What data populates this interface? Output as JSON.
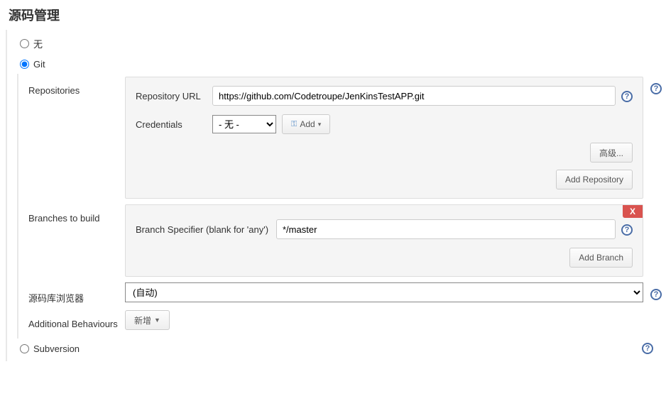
{
  "title": "源码管理",
  "scm": {
    "none_label": "无",
    "git_label": "Git",
    "subversion_label": "Subversion"
  },
  "repositories": {
    "section_label": "Repositories",
    "url_label": "Repository URL",
    "url_value": "https://github.com/Codetroupe/JenKinsTestAPP.git",
    "credentials_label": "Credentials",
    "credentials_value": "- 无 -",
    "add_button": "Add",
    "advanced_button": "高级...",
    "add_repo_button": "Add Repository"
  },
  "branches": {
    "section_label": "Branches to build",
    "specifier_label": "Branch Specifier (blank for 'any')",
    "specifier_value": "*/master",
    "add_branch_button": "Add Branch",
    "delete_label": "X"
  },
  "browser": {
    "section_label": "源码库浏览器",
    "value": "(自动)"
  },
  "behaviours": {
    "section_label": "Additional Behaviours",
    "add_button": "新增"
  }
}
